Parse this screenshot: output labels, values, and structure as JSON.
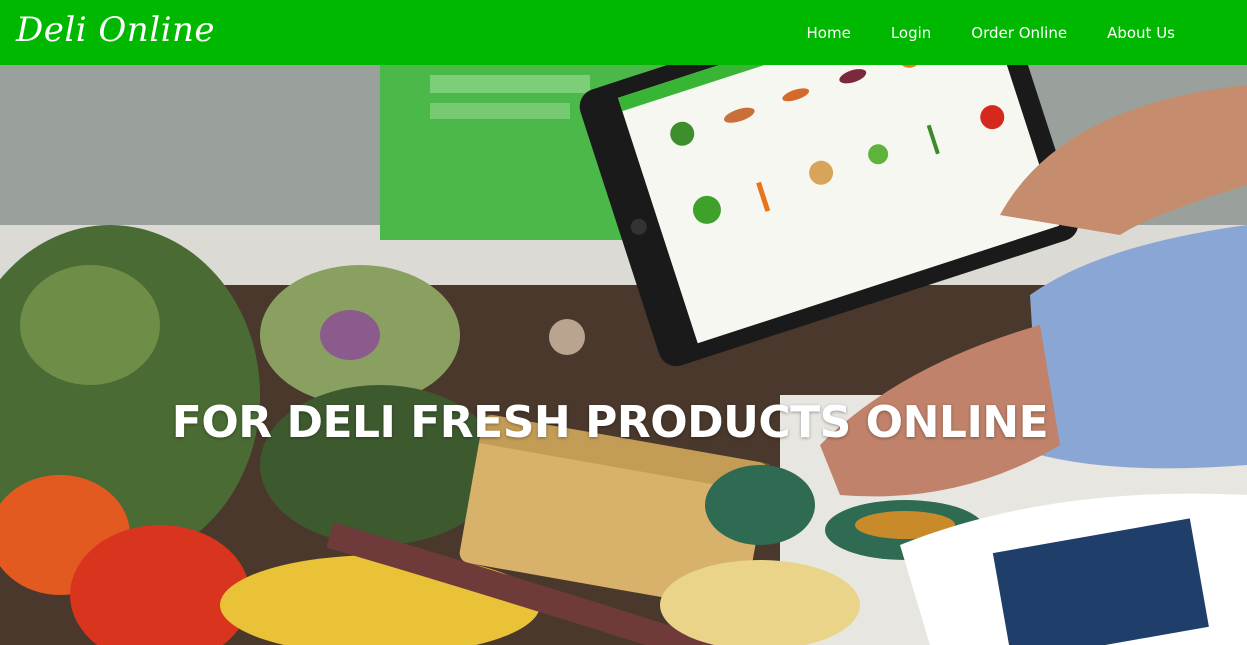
{
  "navbar": {
    "brand": "Deli Online",
    "background_color": "#00b800",
    "links": [
      {
        "label": "Home"
      },
      {
        "label": "Login"
      },
      {
        "label": "Order Online"
      },
      {
        "label": "About Us"
      }
    ]
  },
  "hero": {
    "title": "FOR DELI FRESH PRODUCTS ONLINE",
    "image_icon": "grocery-tablet-photo"
  }
}
